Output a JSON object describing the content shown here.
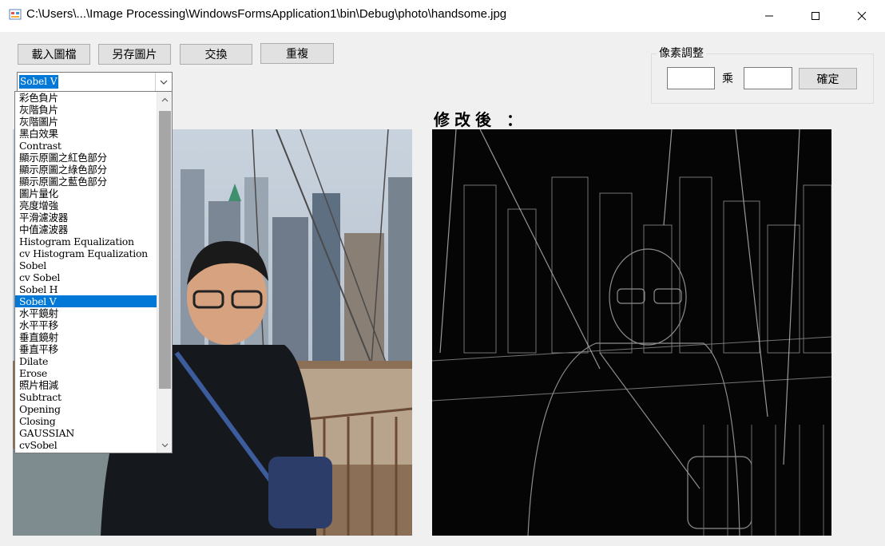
{
  "window": {
    "title": "C:\\Users\\...\\Image Processing\\WindowsFormsApplication1\\bin\\Debug\\photo\\handsome.jpg",
    "controls": {
      "minimize": "minimize-icon",
      "maximize": "maximize-icon",
      "close": "close-icon"
    }
  },
  "toolbar": {
    "load_label": "載入圖檔",
    "save_label": "另存圖片",
    "swap_label": "交換",
    "repeat_label": "重複"
  },
  "combo": {
    "selected": "Sobel V",
    "options": [
      "彩色負片",
      "灰階負片",
      "灰階圖片",
      "黑白效果",
      "Contrast",
      "顯示原圖之紅色部分",
      "顯示原圖之綠色部分",
      "顯示原圖之藍色部分",
      "圖片量化",
      "亮度增強",
      "平滑濾波器",
      "中值濾波器",
      "Histogram Equalization",
      "cv Histogram Equalization",
      "Sobel",
      "cv Sobel",
      "Sobel H",
      "Sobel V",
      "水平鏡射",
      "水平平移",
      "垂直鏡射",
      "垂直平移",
      "Dilate",
      "Erose",
      "照片相減",
      "Subtract",
      "Opening",
      "Closing",
      "GAUSSIAN",
      "cvSobel"
    ],
    "selected_index": 17
  },
  "pixel_adjust": {
    "title": "像素調整",
    "multiply_label": "乘",
    "confirm_label": "確定",
    "value_a": "",
    "value_b": ""
  },
  "labels": {
    "original": "",
    "modified": "修改後 ："
  },
  "colors": {
    "accent": "#0078d7",
    "window_bg": "#f0f0f0"
  }
}
